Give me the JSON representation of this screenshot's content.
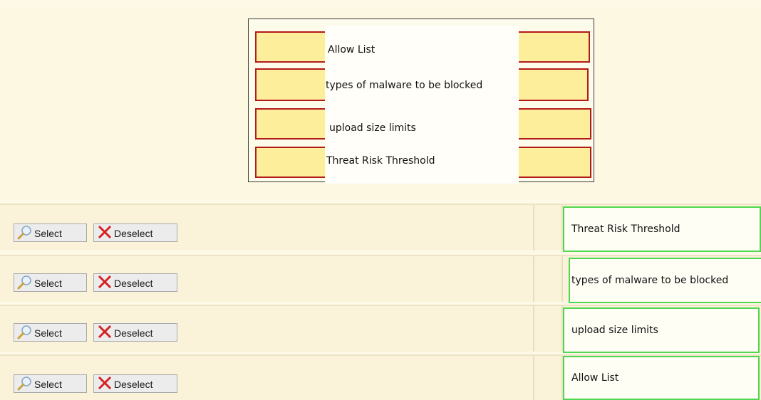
{
  "top_box": {
    "labels": [
      "Allow List",
      "types of malware to be blocked",
      "upload size limits",
      "Threat Risk Threshold"
    ]
  },
  "rows": [
    {
      "select_label": "Select",
      "deselect_label": "Deselect",
      "answer": "Threat Risk Threshold"
    },
    {
      "select_label": "Select",
      "deselect_label": "Deselect",
      "answer": "types of malware to be blocked"
    },
    {
      "select_label": "Select",
      "deselect_label": "Deselect",
      "answer": "upload size limits"
    },
    {
      "select_label": "Select",
      "deselect_label": "Deselect",
      "answer": "Allow List"
    }
  ],
  "icons": {
    "select": "magnifier-icon",
    "deselect": "red-x-icon"
  },
  "colors": {
    "slot_fill": "#fdee9c",
    "slot_border": "#b21a1a",
    "answer_border": "#4fd84f",
    "deselect_x": "#d42222"
  }
}
